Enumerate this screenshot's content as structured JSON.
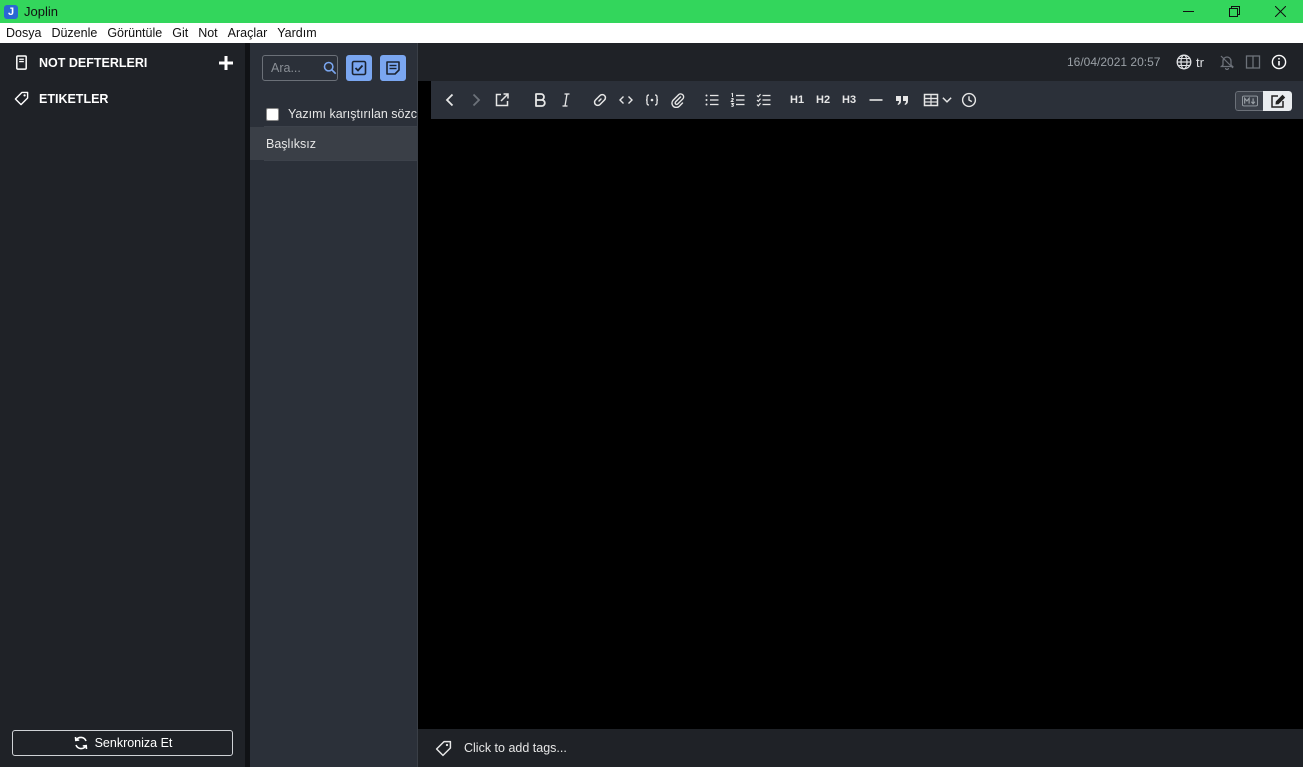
{
  "window": {
    "title": "Joplin",
    "logo_letter": "J"
  },
  "menu": [
    "Dosya",
    "Düzenle",
    "Görüntüle",
    "Git",
    "Not",
    "Araçlar",
    "Yardım"
  ],
  "sidebar": {
    "notebooks_label": "NOT DEFTERLERI",
    "tags_label": "ETIKETLER",
    "sync_label": "Senkroniza Et"
  },
  "notelist": {
    "search_placeholder": "Ara...",
    "items": [
      {
        "title": "Yazımı karıştırılan sözcükler",
        "type": "todo",
        "checked": false
      },
      {
        "title": "Başlıksız",
        "type": "note",
        "selected": true
      }
    ]
  },
  "editor": {
    "date": "16/04/2021 20:57",
    "language": "tr",
    "toolbar": {
      "h1": "H1",
      "h2": "H2",
      "h3": "H3"
    },
    "tags_placeholder": "Click to add tags..."
  },
  "colors": {
    "titlebar": "#33d65c",
    "sidebar_bg": "#1f2227",
    "notelist_bg": "#2b3039",
    "accent_button": "#7aa6f0",
    "editor_bg": "#000000"
  }
}
